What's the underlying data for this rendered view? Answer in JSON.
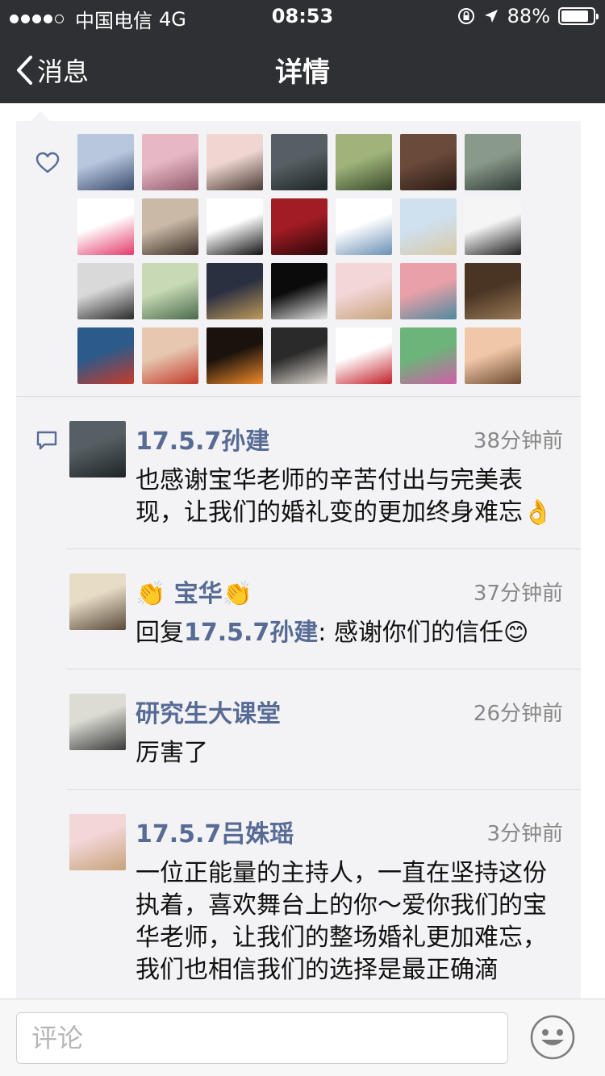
{
  "status_bar": {
    "carrier": "中国电信",
    "network": "4G",
    "time": "08:53",
    "battery": "88%",
    "battery_level": 0.88
  },
  "nav": {
    "back_label": "消息",
    "title": "详情"
  },
  "likes": {
    "avatars": [
      {
        "name": "a1",
        "c1": "#b9c7de",
        "c2": "#3a4c6e"
      },
      {
        "name": "a2",
        "c1": "#e7b7c5",
        "c2": "#8e5a6a"
      },
      {
        "name": "a3",
        "c1": "#f0d6d0",
        "c2": "#4a3a35"
      },
      {
        "name": "a4",
        "c1": "#566064",
        "c2": "#1f2426"
      },
      {
        "name": "a5",
        "c1": "#9fb37a",
        "c2": "#3b4a2b"
      },
      {
        "name": "a6",
        "c1": "#6a4a3a",
        "c2": "#2a1a14"
      },
      {
        "name": "a7",
        "c1": "#8a9a8a",
        "c2": "#2f3a36"
      },
      {
        "name": "a8",
        "c1": "#ffffff",
        "c2": "#e33b6a"
      },
      {
        "name": "a9",
        "c1": "#c9b9a6",
        "c2": "#3b2e26"
      },
      {
        "name": "a10",
        "c1": "#ffffff",
        "c2": "#111111"
      },
      {
        "name": "a11",
        "c1": "#a11c24",
        "c2": "#2a0608"
      },
      {
        "name": "a12",
        "c1": "#ffffff",
        "c2": "#6a8fb5"
      },
      {
        "name": "a13",
        "c1": "#cfe0ef",
        "c2": "#d9c9a8"
      },
      {
        "name": "a14",
        "c1": "#f5f5f5",
        "c2": "#1e1e1e"
      },
      {
        "name": "a15",
        "c1": "#d9d9d9",
        "c2": "#2a2a2a"
      },
      {
        "name": "a16",
        "c1": "#c7d9b5",
        "c2": "#4a6a4a"
      },
      {
        "name": "a17",
        "c1": "#2b3040",
        "c2": "#c09a5a"
      },
      {
        "name": "a18",
        "c1": "#0b0b0b",
        "c2": "#e5e5e5"
      },
      {
        "name": "a19",
        "c1": "#f2d6d8",
        "c2": "#c7a37a"
      },
      {
        "name": "a20",
        "c1": "#e9a0a8",
        "c2": "#4e8aa0"
      },
      {
        "name": "a21",
        "c1": "#4a3524",
        "c2": "#9a7a56"
      },
      {
        "name": "a22",
        "c1": "#2c5a8a",
        "c2": "#c73a2a"
      },
      {
        "name": "a23",
        "c1": "#e7c7b0",
        "c2": "#c23a2a"
      },
      {
        "name": "a24",
        "c1": "#1a120c",
        "c2": "#f08a2a"
      },
      {
        "name": "a25",
        "c1": "#2a2a2a",
        "c2": "#e0d8d0"
      },
      {
        "name": "a26",
        "c1": "#ffffff",
        "c2": "#c21f2a"
      },
      {
        "name": "a27",
        "c1": "#6bb57a",
        "c2": "#d05fa6"
      },
      {
        "name": "a28",
        "c1": "#f0c7a8",
        "c2": "#6e4a2e"
      }
    ]
  },
  "comments": [
    {
      "name": "17.5.7孙建",
      "time": "38分钟前",
      "text": "也感谢宝华老师的辛苦付出与完美表现，让我们的婚礼变的更加终身难忘👌",
      "avatar": {
        "c1": "#566064",
        "c2": "#1f2426"
      }
    },
    {
      "name": "👏 宝华👏",
      "time": "37分钟前",
      "reply_prefix": "回复",
      "reply_to": "17.5.7孙建",
      "reply_sep": ": ",
      "text": "感谢你们的信任😊",
      "avatar": {
        "c1": "#e7dcc6",
        "c2": "#5a4a3a"
      }
    },
    {
      "name": "研究生大课堂",
      "time": "26分钟前",
      "text": "厉害了",
      "avatar": {
        "c1": "#dcdcd4",
        "c2": "#3a3a3a"
      }
    },
    {
      "name": "17.5.7吕姝瑶",
      "time": "3分钟前",
      "text": "一位正能量的主持人，一直在坚持这份执着，喜欢舞台上的你～爱你我们的宝华老师，让我们的整场婚礼更加难忘，我们也相信我们的选择是最正确滴",
      "avatar": {
        "c1": "#f2d6d8",
        "c2": "#c7a37a"
      }
    }
  ],
  "input": {
    "placeholder": "评论"
  },
  "icons": {
    "back": "chevron-left-icon",
    "like": "heart-icon",
    "comment": "comment-bubble-icon",
    "emoji": "smiley-icon"
  }
}
